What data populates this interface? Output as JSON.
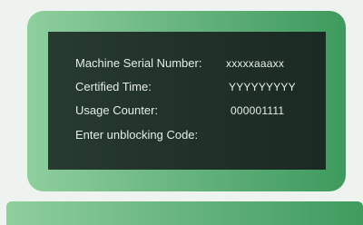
{
  "terminal": {
    "fields": {
      "serial": {
        "label": "Machine Serial Number:",
        "value": "xxxxxaaaxx"
      },
      "certified": {
        "label": "Certified Time:",
        "value": "YYYYYYYYY"
      },
      "usage": {
        "label": "Usage Counter:",
        "value": "000001111"
      },
      "unblock": {
        "label": "Enter unblocking Code:",
        "value": ""
      }
    }
  },
  "colors": {
    "monitor_frame": "#6ab681",
    "screen_background": "#203128",
    "screen_text": "#e4eee7",
    "page_background": "#eff3f0"
  }
}
